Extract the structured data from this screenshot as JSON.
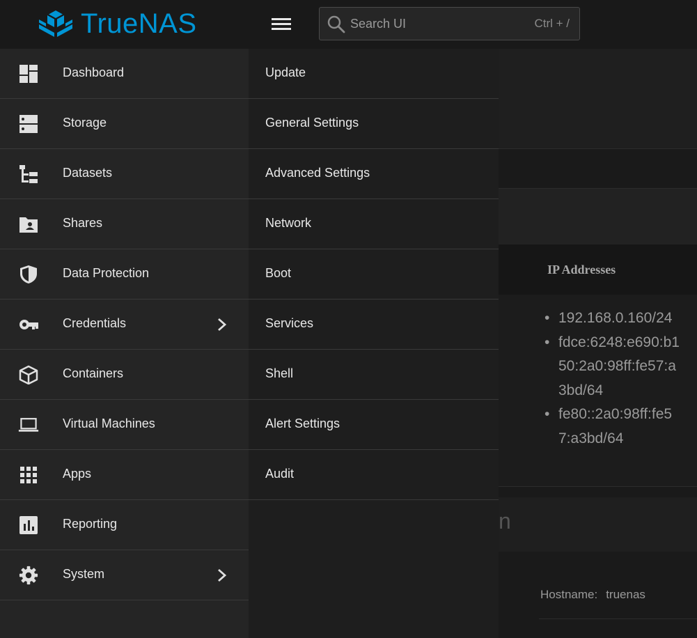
{
  "header": {
    "brand": "TrueNAS",
    "brand_color": "#0095d5",
    "menu_icon": "hamburger-icon",
    "search": {
      "placeholder": "Search UI",
      "shortcut": "Ctrl + /",
      "icon": "search-icon"
    }
  },
  "sidebar": {
    "items": [
      {
        "label": "Dashboard",
        "icon": "dashboard-icon"
      },
      {
        "label": "Storage",
        "icon": "storage-icon"
      },
      {
        "label": "Datasets",
        "icon": "datasets-icon"
      },
      {
        "label": "Shares",
        "icon": "shares-folder-icon"
      },
      {
        "label": "Data Protection",
        "icon": "shield-icon"
      },
      {
        "label": "Credentials",
        "icon": "key-icon",
        "has_submenu": true
      },
      {
        "label": "Containers",
        "icon": "cube-icon"
      },
      {
        "label": "Virtual Machines",
        "icon": "laptop-icon"
      },
      {
        "label": "Apps",
        "icon": "apps-grid-icon"
      },
      {
        "label": "Reporting",
        "icon": "bar-chart-icon"
      },
      {
        "label": "System",
        "icon": "gear-icon",
        "has_submenu": true,
        "active": true
      }
    ]
  },
  "submenu": {
    "items": [
      {
        "label": "Update"
      },
      {
        "label": "General Settings"
      },
      {
        "label": "Advanced Settings"
      },
      {
        "label": "Network"
      },
      {
        "label": "Boot"
      },
      {
        "label": "Services"
      },
      {
        "label": "Shell"
      },
      {
        "label": "Alert Settings"
      },
      {
        "label": "Audit"
      }
    ]
  },
  "background": {
    "ip_header": "IP Addresses",
    "ip_addresses": [
      "192.168.0.160/24",
      "fdce:6248:e690:b150:2a0:98ff:fe57:a3bd/64",
      "fe80::2a0:98ff:fe57:a3bd/64"
    ],
    "partial_heading": "n",
    "hostname_label": "Hostname:",
    "hostname_value": "truenas"
  }
}
